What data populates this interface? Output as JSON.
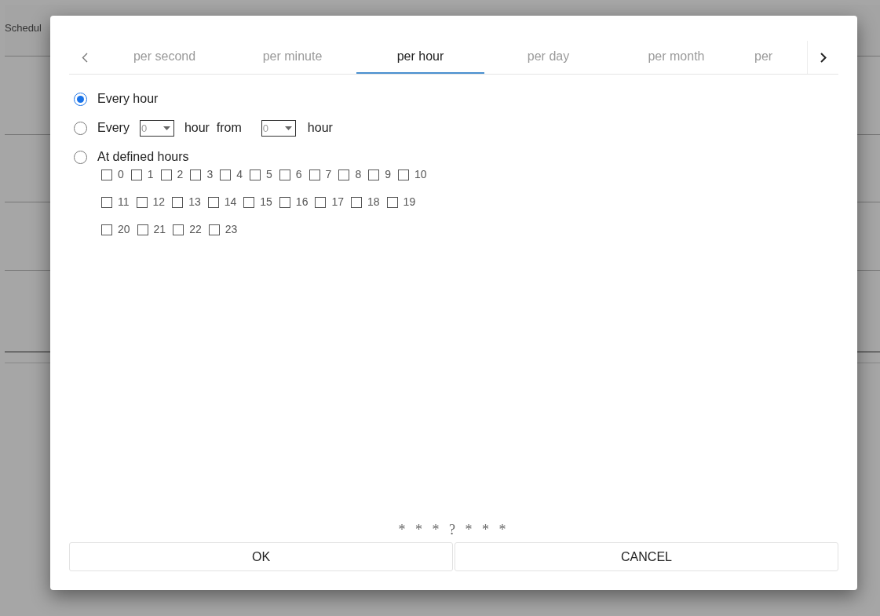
{
  "background": {
    "title": "Schedul"
  },
  "dialog": {
    "tabs": [
      {
        "label": "per second",
        "selected": false
      },
      {
        "label": "per minute",
        "selected": false
      },
      {
        "label": "per hour",
        "selected": true
      },
      {
        "label": "per day",
        "selected": false
      },
      {
        "label": "per month",
        "selected": false
      },
      {
        "label": "per",
        "selected": false
      }
    ],
    "options": [
      {
        "kind": "plain",
        "selected": true,
        "label": "Every hour"
      },
      {
        "kind": "interval",
        "selected": false,
        "parts": [
          "Every",
          "hour  from",
          "hour"
        ],
        "dropdowns": [
          {
            "value": "0"
          },
          {
            "value": "0"
          }
        ]
      },
      {
        "kind": "hours",
        "selected": false,
        "label": "At defined hours",
        "hour_rows": [
          [
            {
              "label": "0",
              "checked": false
            },
            {
              "label": "1",
              "checked": false
            },
            {
              "label": "2",
              "checked": false
            },
            {
              "label": "3",
              "checked": false
            },
            {
              "label": "4",
              "checked": false
            },
            {
              "label": "5",
              "checked": false
            },
            {
              "label": "6",
              "checked": false
            },
            {
              "label": "7",
              "checked": false
            },
            {
              "label": "8",
              "checked": false
            },
            {
              "label": "9",
              "checked": false
            },
            {
              "label": "10",
              "checked": false
            }
          ],
          [
            {
              "label": "11",
              "checked": false
            },
            {
              "label": "12",
              "checked": false
            },
            {
              "label": "13",
              "checked": false
            },
            {
              "label": "14",
              "checked": false
            },
            {
              "label": "15",
              "checked": false
            },
            {
              "label": "16",
              "checked": false
            },
            {
              "label": "17",
              "checked": false
            },
            {
              "label": "18",
              "checked": false
            },
            {
              "label": "19",
              "checked": false
            }
          ],
          [
            {
              "label": "20",
              "checked": false
            },
            {
              "label": "21",
              "checked": false
            },
            {
              "label": "22",
              "checked": false
            },
            {
              "label": "23",
              "checked": false
            }
          ]
        ]
      }
    ],
    "expression": "* * * ? * * *",
    "buttons": [
      "OK",
      "CANCEL"
    ]
  }
}
